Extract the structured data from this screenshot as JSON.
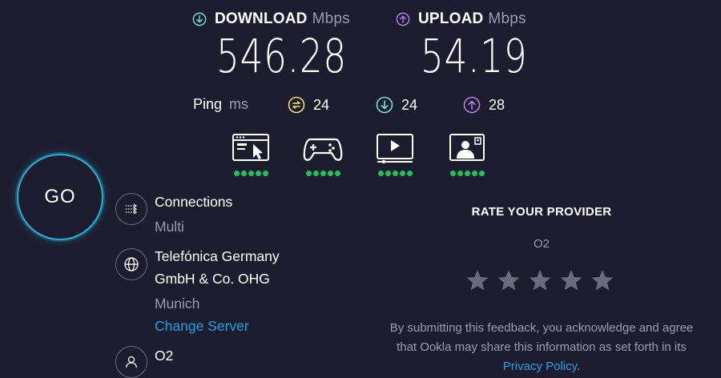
{
  "download": {
    "label": "DOWNLOAD",
    "unit": "Mbps",
    "value": "546.28"
  },
  "upload": {
    "label": "UPLOAD",
    "unit": "Mbps",
    "value": "54.19"
  },
  "ping": {
    "label": "Ping",
    "unit": "ms",
    "idle": "24",
    "download": "24",
    "upload": "28"
  },
  "categories": [
    {
      "name": "web-browsing-icon",
      "rating": 5
    },
    {
      "name": "gaming-icon",
      "rating": 5
    },
    {
      "name": "video-streaming-icon",
      "rating": 5
    },
    {
      "name": "video-chat-icon",
      "rating": 5
    }
  ],
  "go_button": "GO",
  "connections": {
    "title": "Connections",
    "value": "Multi"
  },
  "server": {
    "name_line1": "Telefónica Germany",
    "name_line2": "GmbH & Co. OHG",
    "location": "Munich",
    "change_link": "Change Server"
  },
  "provider": {
    "name": "O2"
  },
  "rate": {
    "title": "RATE YOUR PROVIDER",
    "provider": "O2",
    "stars": 5,
    "disclaimer_prefix": "By submitting this feedback, you acknowledge and agree that Ookla may share this information as set forth in its ",
    "privacy_link": "Privacy Policy",
    "disclaimer_suffix": "."
  },
  "colors": {
    "background": "#1c1c2e",
    "download_accent": "#6ee0d5",
    "upload_accent": "#b57cf0",
    "ping_accent": "#e8e06a",
    "link": "#1aa3e8",
    "go_ring": "#25b3d6",
    "rating_dot": "#20c35a",
    "star": "#6a6a80"
  }
}
